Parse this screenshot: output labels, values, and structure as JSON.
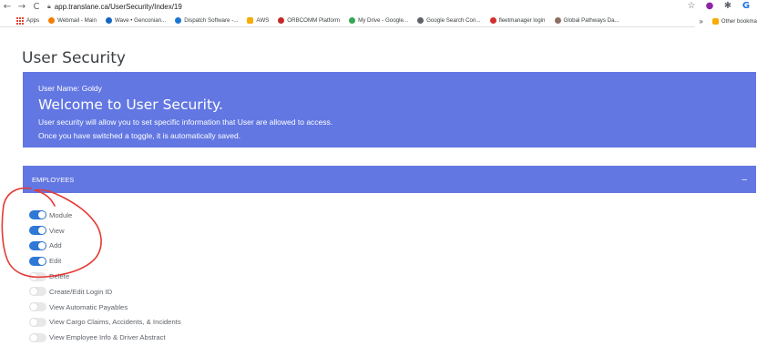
{
  "browser": {
    "url": "app.translane.ca/UserSecurity/Index/19",
    "nav": {
      "back": "←",
      "forward": "→",
      "reload": "C"
    },
    "right_icons": [
      "star-icon",
      "color-wheel-icon",
      "puzzle-icon",
      "profile-icon"
    ],
    "right_glyphs": {
      "star": "☆",
      "wheel": "●",
      "puzzle": "✱",
      "profile": "G"
    }
  },
  "bookmarks": {
    "items": [
      {
        "label": "Apps",
        "icon": "apps-grid-icon",
        "color": "#ea4335"
      },
      {
        "label": "Webmail - Main",
        "icon": "webmail-icon",
        "color": "#f57c00"
      },
      {
        "label": "Wave • Genconian...",
        "icon": "wave-icon",
        "color": "#1565c0"
      },
      {
        "label": "Dispatch Software -...",
        "icon": "dispatch-icon",
        "color": "#1976d2"
      },
      {
        "label": "AWS",
        "icon": "folder-icon",
        "color": "#f9ab00"
      },
      {
        "label": "ORBCOMM Platform",
        "icon": "orbcomm-icon",
        "color": "#c62828"
      },
      {
        "label": "My Drive - Google...",
        "icon": "drive-icon",
        "color": "#34a853"
      },
      {
        "label": "Google Search Con...",
        "icon": "search-console-icon",
        "color": "#5f6368"
      },
      {
        "label": "fleetmanager login",
        "icon": "fleetmanager-icon",
        "color": "#d32f2f"
      },
      {
        "label": "Global Pathways Da...",
        "icon": "globe-icon",
        "color": "#8d6e63"
      }
    ],
    "overflow": "»",
    "other": "Other bookma"
  },
  "page": {
    "title": "User Security"
  },
  "banner": {
    "username": "User Name: Goldy",
    "welcome": "Welcome to User Security.",
    "line1": "User security will allow you to set specific information that User are allowed to access.",
    "line2": "Once you have switched a toggle, it is automatically saved."
  },
  "section": {
    "title": "EMPLOYEES",
    "collapse": "–"
  },
  "permissions": [
    {
      "label": "Module",
      "on": true
    },
    {
      "label": "View",
      "on": true
    },
    {
      "label": "Add",
      "on": true
    },
    {
      "label": "Edit",
      "on": true
    },
    {
      "label": "Delete",
      "on": false
    },
    {
      "label": "Create/Edit Login ID",
      "on": false
    },
    {
      "label": "View Automatic Payables",
      "on": false
    },
    {
      "label": "View Cargo Claims, Accidents, & Incidents",
      "on": false
    },
    {
      "label": "View Employee Info & Driver Abstract",
      "on": false
    }
  ],
  "colors": {
    "accent": "#6277e2",
    "toggle_on": "#2f78d6",
    "annotation": "#e53935"
  }
}
